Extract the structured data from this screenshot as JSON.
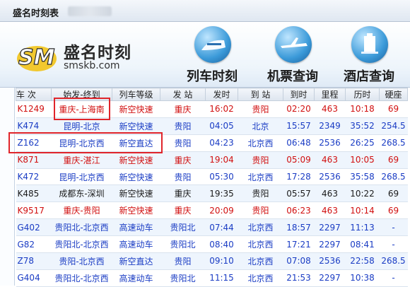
{
  "window": {
    "title": "盛名时刻表"
  },
  "brand": {
    "name": "盛名时刻",
    "url": "smskb.com",
    "logo_letters": "SM"
  },
  "nav": [
    {
      "label": "列车时刻",
      "icon": "train-icon"
    },
    {
      "label": "机票查询",
      "icon": "airplane-icon"
    },
    {
      "label": "酒店查询",
      "icon": "hotel-icon"
    }
  ],
  "table": {
    "headers": [
      "车 次",
      "始发-终到",
      "列车等级",
      "发 站",
      "发时",
      "到 站",
      "到时",
      "里程",
      "历时",
      "硬座"
    ],
    "rows": [
      {
        "color": "red",
        "cells": [
          "K1249",
          "重庆-上海南",
          "新空快速",
          "重庆",
          "16:02",
          "贵阳",
          "02:20",
          "463",
          "10:18",
          "69"
        ]
      },
      {
        "color": "blue",
        "cells": [
          "K474",
          "昆明-北京",
          "新空快速",
          "贵阳",
          "04:05",
          "北京",
          "15:57",
          "2349",
          "35:52",
          "254.5"
        ]
      },
      {
        "color": "blue",
        "cells": [
          "Z162",
          "昆明-北京西",
          "新空直达",
          "贵阳",
          "04:23",
          "北京西",
          "06:48",
          "2536",
          "26:25",
          "268.5"
        ]
      },
      {
        "color": "red",
        "cells": [
          "K871",
          "重庆-湛江",
          "新空快速",
          "重庆",
          "19:04",
          "贵阳",
          "05:09",
          "463",
          "10:05",
          "69"
        ]
      },
      {
        "color": "blue",
        "cells": [
          "K472",
          "昆明-北京西",
          "新空快速",
          "贵阳",
          "05:30",
          "北京西",
          "17:28",
          "2536",
          "35:58",
          "268.5"
        ]
      },
      {
        "color": "black",
        "cells": [
          "K485",
          "成都东-深圳",
          "新空快速",
          "重庆",
          "19:35",
          "贵阳",
          "05:57",
          "463",
          "10:22",
          "69"
        ]
      },
      {
        "color": "red",
        "cells": [
          "K9517",
          "重庆-贵阳",
          "新空快速",
          "重庆",
          "20:09",
          "贵阳",
          "06:23",
          "463",
          "10:14",
          "69"
        ]
      },
      {
        "color": "blue",
        "cells": [
          "G402",
          "贵阳北-北京西",
          "高速动车",
          "贵阳北",
          "07:44",
          "北京西",
          "18:57",
          "2297",
          "11:13",
          "-"
        ]
      },
      {
        "color": "blue",
        "cells": [
          "G82",
          "贵阳北-北京西",
          "高速动车",
          "贵阳北",
          "08:40",
          "北京西",
          "17:21",
          "2297",
          "08:41",
          "-"
        ]
      },
      {
        "color": "blue",
        "cells": [
          "Z78",
          "贵阳-北京西",
          "新空直达",
          "贵阳",
          "09:10",
          "北京西",
          "07:08",
          "2536",
          "22:58",
          "268.5"
        ]
      },
      {
        "color": "blue",
        "cells": [
          "G404",
          "贵阳北-北京西",
          "高速动车",
          "贵阳北",
          "11:15",
          "北京西",
          "21:53",
          "2297",
          "10:38",
          "-"
        ]
      }
    ]
  },
  "colors": {
    "red": "#d10f0f",
    "blue": "#1a3cc4",
    "highlight": "#e0252b"
  }
}
